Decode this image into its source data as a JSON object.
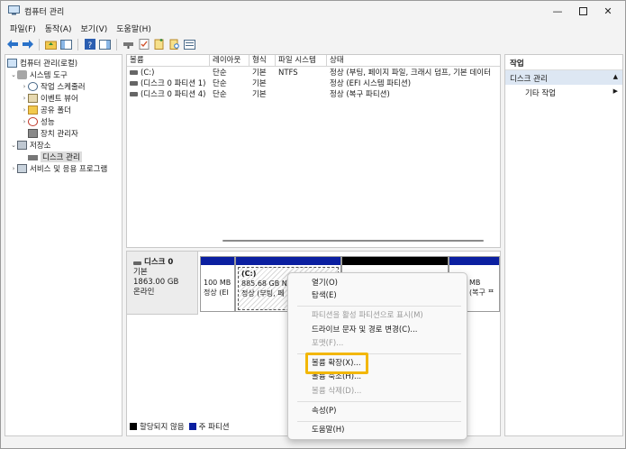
{
  "window": {
    "title": "컴퓨터 관리"
  },
  "menubar": [
    "파일(F)",
    "동작(A)",
    "보기(V)",
    "도움말(H)"
  ],
  "tree": {
    "root": "컴퓨터 관리(로컬)",
    "system_tools": "시스템 도구",
    "task_scheduler": "작업 스케줄러",
    "event_viewer": "이벤트 뷰어",
    "shared_folders": "공유 폴더",
    "performance": "성능",
    "device_manager": "장치 관리자",
    "storage": "저장소",
    "disk_management": "디스크 관리",
    "services": "서비스 및 응용 프로그램"
  },
  "volume_list": {
    "headers": [
      "볼륨",
      "레이아웃",
      "형식",
      "파일 시스템",
      "상태"
    ],
    "rows": [
      [
        "(C:)",
        "단순",
        "기본",
        "NTFS",
        "정상 (부팅, 페이지 파일, 크래시 덤프, 기본 데이터"
      ],
      [
        "(디스크 0 파티션 1)",
        "단순",
        "기본",
        "",
        "정상 (EFI 시스템 파티션)"
      ],
      [
        "(디스크 0 파티션 4)",
        "단순",
        "기본",
        "",
        "정상 (복구 파티션)"
      ]
    ]
  },
  "disk": {
    "name": "디스크 0",
    "type": "기본",
    "size": "1863.00 GB",
    "status": "온라인",
    "partitions": [
      {
        "line1": "",
        "line2": "100 MB",
        "line3": "정상 (EI"
      },
      {
        "line1": "(C:)",
        "line2": "885.68 GB NT",
        "line3": "정상 (부팅, 페"
      },
      {
        "line1": "",
        "line2": "",
        "line3": ""
      },
      {
        "line1": "",
        "line2": "MB",
        "line3": "(복구 ᄑ"
      }
    ]
  },
  "legend": {
    "unallocated": "할당되지 않음",
    "primary": "주 파티션"
  },
  "actions": {
    "header": "작업",
    "section": "디스크 관리",
    "more": "기타 작업"
  },
  "context_menu": {
    "open": "열기(O)",
    "explore": "탐색(E)",
    "mark_active": "파티션을 활성 파티션으로 표시(M)",
    "change_letter": "드라이브 문자 및 경로 변경(C)...",
    "format": "포맷(F)...",
    "extend": "볼륨 확장(X)...",
    "shrink": "볼륨 축소(H)...",
    "delete": "볼륨 삭제(D)...",
    "properties": "속성(P)",
    "help": "도움말(H)"
  },
  "colors": {
    "primary_partition": "#0b1fa0",
    "highlight": "#f2b705",
    "action_section": "#dde7f3"
  }
}
